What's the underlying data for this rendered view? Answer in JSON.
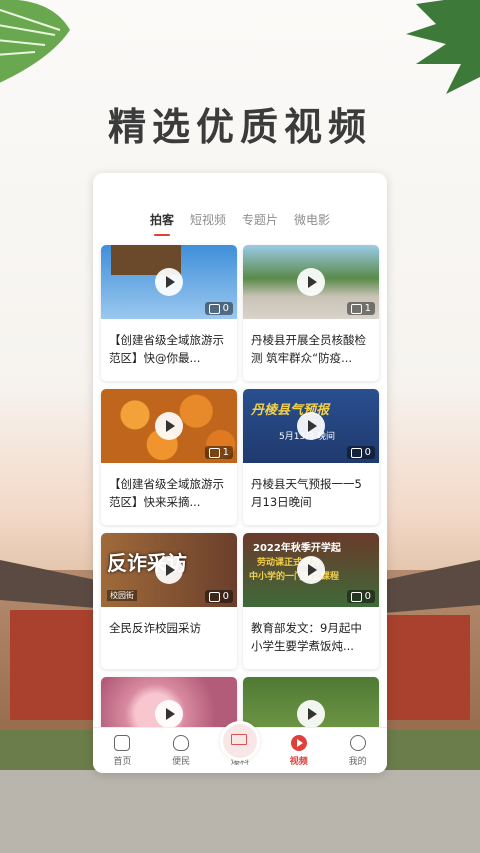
{
  "headline": "精选优质视频",
  "tabs": [
    "拍客",
    "短视频",
    "专题片",
    "微电影"
  ],
  "cards": [
    {
      "caption": "【创建省级全域旅游示范区】快@你最...",
      "likes": "0"
    },
    {
      "caption": "丹棱县开展全员核酸检测 筑牢群众“防疫...",
      "likes": "1"
    },
    {
      "caption": "【创建省级全域旅游示范区】快来采摘...",
      "likes": "1"
    },
    {
      "caption": "丹棱县天气预报一一5月13日晚间",
      "likes": "0",
      "overlay": "丹棱县气预报",
      "overlay2": "5月13日 晚间"
    },
    {
      "caption": "全民反诈校园采访",
      "likes": "0",
      "overlay": "反诈采访",
      "overlay2": "校园街"
    },
    {
      "caption": "教育部发文：9月起中小学生要学煮饭炖...",
      "likes": "0",
      "overlay": "2022年秋季开学起",
      "overlay2": "劳动课正式成为",
      "overlay3": "中小学的一门独立课程"
    },
    {
      "caption": "",
      "likes": ""
    },
    {
      "caption": "",
      "likes": ""
    }
  ],
  "nav": {
    "home": "首页",
    "service": "便民",
    "report": "爆料",
    "video": "视频",
    "mine": "我的"
  },
  "colors": {
    "accent": "#e0403a"
  }
}
